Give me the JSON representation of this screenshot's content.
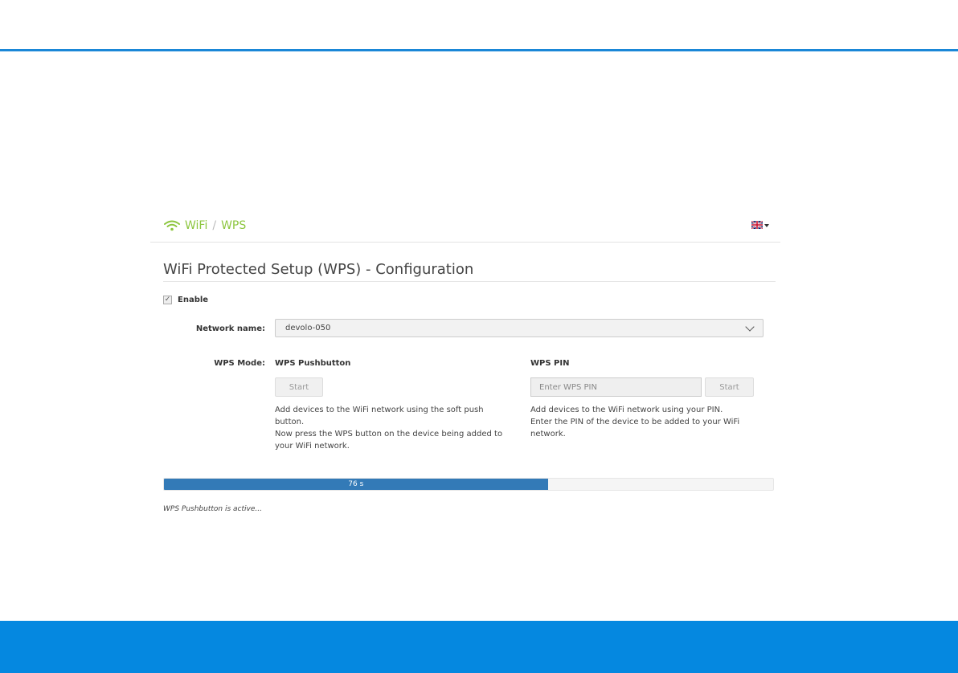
{
  "breadcrumb": {
    "section": "WiFi",
    "separator": "/",
    "page": "WPS"
  },
  "language": {
    "icon": "uk-flag-icon"
  },
  "page": {
    "title": "WiFi Protected Setup (WPS) - Configuration"
  },
  "enable": {
    "label": "Enable",
    "checked": true
  },
  "network": {
    "label": "Network name:",
    "selected": "devolo-050"
  },
  "wps_mode": {
    "label": "WPS Mode:"
  },
  "pushbutton": {
    "heading": "WPS Pushbutton",
    "button_label": "Start",
    "description_1": "Add devices to the WiFi network using the soft push button.",
    "description_2": "Now press the WPS button on the device being added to your WiFi network."
  },
  "pin": {
    "heading": "WPS PIN",
    "placeholder": "Enter WPS PIN",
    "button_label": "Start",
    "description_1": "Add devices to the WiFi network using your PIN.",
    "description_2": "Enter the PIN of the device to be added to your WiFi network."
  },
  "progress": {
    "label": "76 s",
    "fraction": 0.63
  },
  "status": {
    "text": "WPS Pushbutton is active..."
  },
  "colors": {
    "accent_blue": "#0588e0",
    "breadcrumb_green": "#8dc63f",
    "progress_blue": "#337ab7"
  }
}
